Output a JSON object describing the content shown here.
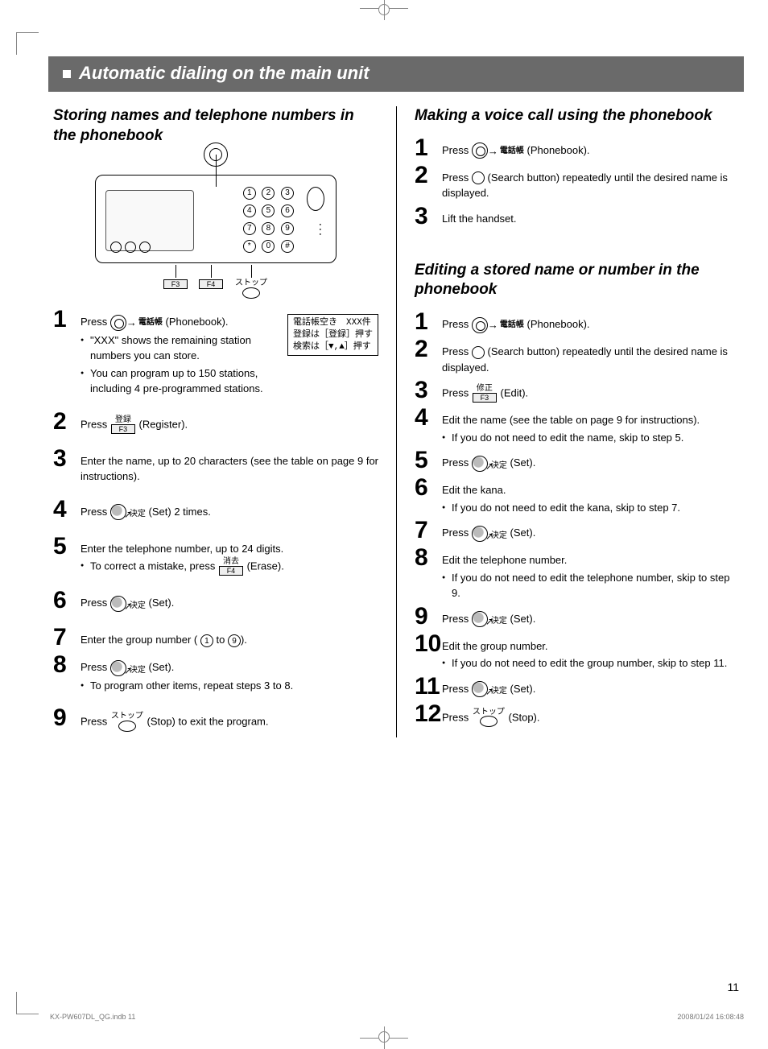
{
  "pageTitle": "Automatic dialing on the main unit",
  "pageNumber": "11",
  "footer": {
    "file": "KX-PW607DL_QG.indb   11",
    "datetime": "2008/01/24   16:08:48"
  },
  "left": {
    "heading": "Storing names and telephone numbers in the phonebook",
    "diagram": {
      "f3": "F3",
      "f4": "F4",
      "stopJp": "ストップ",
      "keys": [
        "1",
        "2",
        "3",
        "4",
        "5",
        "6",
        "7",
        "8",
        "9",
        "*",
        "0",
        "#"
      ]
    },
    "steps": {
      "1": {
        "press": "Press",
        "phonebookLabel": "電話帳",
        "phonebookSuffix": "(Phonebook).",
        "bullets": [
          "\"XXX\" shows the remaining station numbers you can store.",
          "You can program up to 150 stations, including 4 pre-programmed stations."
        ],
        "display": {
          "l1": "電話帳空き　XXX件",
          "l2": "登録は［登録］押す",
          "l3": "検索は［▼,▲］押す"
        }
      },
      "2": {
        "press": "Press",
        "btnTop": "登録",
        "btnF": "F3",
        "suffix": "(Register)."
      },
      "3": {
        "text": "Enter the name, up to 20 characters (see the table on page 9 for instructions)."
      },
      "4": {
        "press": "Press",
        "setLabel": "決定",
        "suffix": "(Set) 2 times."
      },
      "5": {
        "text": "Enter the telephone number, up to 24 digits.",
        "bulletPrefix": "To correct a mistake, press",
        "eraseTop": "消去",
        "eraseF": "F4",
        "eraseSuffix": "(Erase)."
      },
      "6": {
        "press": "Press",
        "setLabel": "決定",
        "suffix": "(Set)."
      },
      "7": {
        "prefix": "Enter the group number (",
        "to": "to",
        "suffix": ")."
      },
      "8": {
        "press": "Press",
        "setLabel": "決定",
        "suffix": "(Set).",
        "bullet": "To program other items, repeat steps 3 to 8."
      },
      "9": {
        "press": "Press",
        "stopJp": "ストップ",
        "suffix": "(Stop) to exit the program."
      }
    }
  },
  "right": {
    "sectionA": {
      "heading": "Making a voice call using the phonebook",
      "steps": {
        "1": {
          "press": "Press",
          "phonebookLabel": "電話帳",
          "suffix": "(Phonebook)."
        },
        "2": {
          "press": "Press",
          "suffix": "(Search button) repeatedly until the desired name is displayed."
        },
        "3": {
          "text": "Lift the handset."
        }
      }
    },
    "sectionB": {
      "heading": "Editing a stored name or number in the phonebook",
      "steps": {
        "1": {
          "press": "Press",
          "phonebookLabel": "電話帳",
          "suffix": "(Phonebook)."
        },
        "2": {
          "press": "Press",
          "suffix": "(Search button) repeatedly until the desired name is displayed."
        },
        "3": {
          "press": "Press",
          "btnTop": "修正",
          "btnF": "F3",
          "suffix": "(Edit)."
        },
        "4": {
          "text": "Edit the name (see the table on page 9 for instructions).",
          "bullet": "If you do not need to edit the name, skip to step 5."
        },
        "5": {
          "press": "Press",
          "setLabel": "決定",
          "suffix": "(Set)."
        },
        "6": {
          "text": "Edit the kana.",
          "bullet": "If you do not need to edit the kana, skip to step 7."
        },
        "7": {
          "press": "Press",
          "setLabel": "決定",
          "suffix": "(Set)."
        },
        "8": {
          "text": "Edit the telephone number.",
          "bullet": "If you do not need to edit the telephone number, skip to step 9."
        },
        "9": {
          "press": "Press",
          "setLabel": "決定",
          "suffix": "(Set)."
        },
        "10": {
          "text": "Edit the group number.",
          "bullet": "If you do not need to edit the group number, skip to step 11."
        },
        "11": {
          "press": "Press",
          "setLabel": "決定",
          "suffix": "(Set)."
        },
        "12": {
          "press": "Press",
          "stopJp": "ストップ",
          "suffix": "(Stop)."
        }
      }
    }
  }
}
